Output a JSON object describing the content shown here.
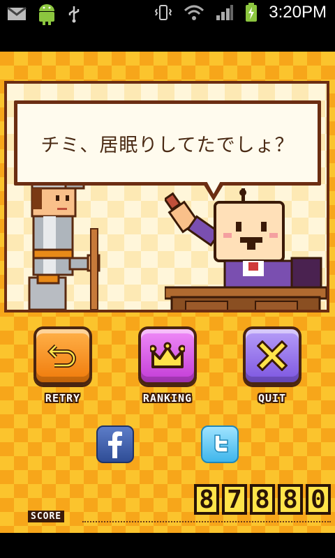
{
  "statusbar": {
    "time": "3:20PM",
    "icons": [
      "gmail-icon",
      "android-icon",
      "usb-icon",
      "vibrate-icon",
      "wifi-icon",
      "signal-icon",
      "battery-charging-icon"
    ]
  },
  "scene": {
    "dialogue": "チミ、居眠りしてたでしょ？"
  },
  "buttons": {
    "retry_label": "RETRY",
    "ranking_label": "RANKING",
    "quit_label": "QUIT"
  },
  "social": [
    "facebook",
    "twitter"
  ],
  "score": {
    "label": "SCORE",
    "value": "87880",
    "digits": [
      "8",
      "7",
      "8",
      "8",
      "0"
    ]
  },
  "colors": {
    "background": "#f7a61a",
    "retry": "#f07a0a",
    "ranking": "#c23bd6",
    "quit": "#7c55e0",
    "score_digit": "#ffe44a"
  }
}
